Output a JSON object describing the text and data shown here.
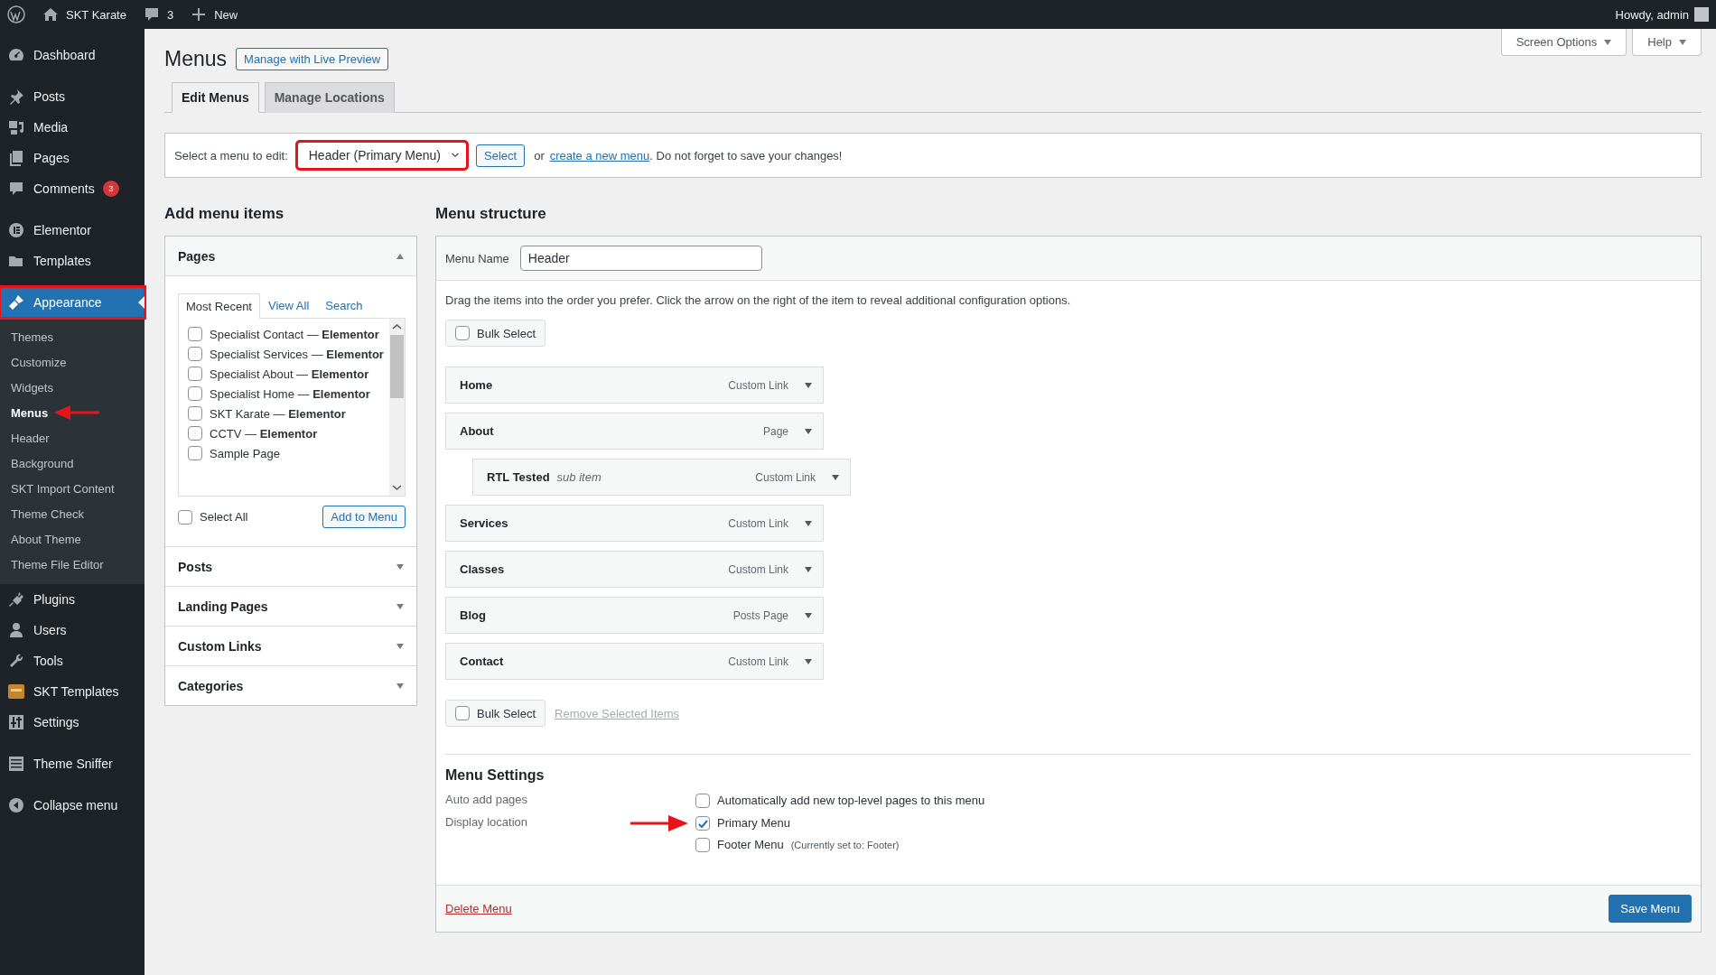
{
  "admin_bar": {
    "site_name": "SKT Karate",
    "comments_count": "3",
    "new_label": "New",
    "greeting": "Howdy, admin"
  },
  "sidebar": {
    "groups": [
      [
        {
          "label": "Dashboard",
          "selected": false
        }
      ],
      [
        {
          "label": "Posts",
          "selected": false
        },
        {
          "label": "Media",
          "selected": false
        },
        {
          "label": "Pages",
          "selected": false
        },
        {
          "label": "Comments",
          "selected": false,
          "badge": "3"
        }
      ],
      [
        {
          "label": "Elementor",
          "selected": false
        },
        {
          "label": "Templates",
          "selected": false
        }
      ],
      [
        {
          "label": "Appearance",
          "selected": true,
          "highlighted": true,
          "children": [
            {
              "label": "Themes",
              "selected": false
            },
            {
              "label": "Customize",
              "selected": false
            },
            {
              "label": "Widgets",
              "selected": false
            },
            {
              "label": "Menus",
              "selected": true,
              "arrow": true
            },
            {
              "label": "Header",
              "selected": false
            },
            {
              "label": "Background",
              "selected": false
            },
            {
              "label": "SKT Import Content",
              "selected": false
            },
            {
              "label": "Theme Check",
              "selected": false
            },
            {
              "label": "About Theme",
              "selected": false
            },
            {
              "label": "Theme File Editor",
              "selected": false
            }
          ]
        },
        {
          "label": "Plugins",
          "selected": false
        },
        {
          "label": "Users",
          "selected": false
        },
        {
          "label": "Tools",
          "selected": false
        },
        {
          "label": "SKT Templates",
          "selected": false
        },
        {
          "label": "Settings",
          "selected": false
        }
      ],
      [
        {
          "label": "Theme Sniffer",
          "selected": false
        }
      ],
      [
        {
          "label": "Collapse menu",
          "selected": false
        }
      ]
    ]
  },
  "page_title": "Menus",
  "live_preview_button": "Manage with Live Preview",
  "screen_meta": [
    "Screen Options",
    "Help"
  ],
  "tabs": [
    {
      "label": "Edit Menus",
      "selected": true
    },
    {
      "label": "Manage Locations",
      "selected": false
    }
  ],
  "menu_select": {
    "label": "Select a menu to edit:",
    "value": "Header (Primary Menu)",
    "highlighted": true,
    "button": "Select",
    "text_before": "or",
    "link": "create a new menu",
    "text_after": ". Do not forget to save your changes!"
  },
  "add_items": {
    "heading": "Add menu items",
    "panels": [
      {
        "title": "Pages",
        "expanded": true,
        "tabs": [
          {
            "label": "Most Recent",
            "selected": true
          },
          {
            "label": "View All",
            "selected": false
          },
          {
            "label": "Search",
            "selected": false
          }
        ],
        "items": [
          {
            "label": "Specialist Contact — **Elementor**",
            "checked": false
          },
          {
            "label": "Specialist Services — **Elementor**",
            "checked": false
          },
          {
            "label": "Specialist About — **Elementor**",
            "checked": false
          },
          {
            "label": "Specialist Home — **Elementor**",
            "checked": false
          },
          {
            "label": "SKT Karate — **Elementor**",
            "checked": false
          },
          {
            "label": "CCTV — **Elementor**",
            "checked": false
          },
          {
            "label": "Sample Page",
            "checked": false
          }
        ],
        "select_all": {
          "label": "Select All",
          "checked": false
        },
        "add_button": "Add to Menu"
      },
      {
        "title": "Posts",
        "expanded": false
      },
      {
        "title": "Landing Pages",
        "expanded": false
      },
      {
        "title": "Custom Links",
        "expanded": false
      },
      {
        "title": "Categories",
        "expanded": false
      }
    ]
  },
  "structure": {
    "heading": "Menu structure",
    "name_label": "Menu Name",
    "name_value": "Header",
    "instructions": "Drag the items into the order you prefer. Click the arrow on the right of the item to reveal additional configuration options.",
    "bulk_select_top": {
      "label": "Bulk Select",
      "checked": false
    },
    "items": [
      {
        "title": "Home",
        "type": "Custom Link"
      },
      {
        "title": "About",
        "type": "Page",
        "children": [
          {
            "title": "RTL Tested",
            "note": "sub item",
            "type": "Custom Link"
          }
        ]
      },
      {
        "title": "Services",
        "type": "Custom Link"
      },
      {
        "title": "Classes",
        "type": "Custom Link"
      },
      {
        "title": "Blog",
        "type": "Posts Page"
      },
      {
        "title": "Contact",
        "type": "Custom Link"
      }
    ],
    "bulk_select_bottom": {
      "label": "Bulk Select",
      "checked": false
    },
    "remove_link": "Remove Selected Items",
    "settings": {
      "heading": "Menu Settings",
      "rows": [
        {
          "label": "Auto add pages",
          "options": [
            {
              "label": "Automatically add new top-level pages to this menu",
              "checked": false
            }
          ]
        },
        {
          "label": "Display location",
          "options": [
            {
              "label": "Primary Menu",
              "checked": true,
              "arrow": true
            },
            {
              "label": "Footer Menu",
              "note": "(Currently set to: Footer)",
              "checked": false
            }
          ]
        }
      ]
    },
    "delete_link": "Delete Menu",
    "save_button": "Save Menu"
  }
}
